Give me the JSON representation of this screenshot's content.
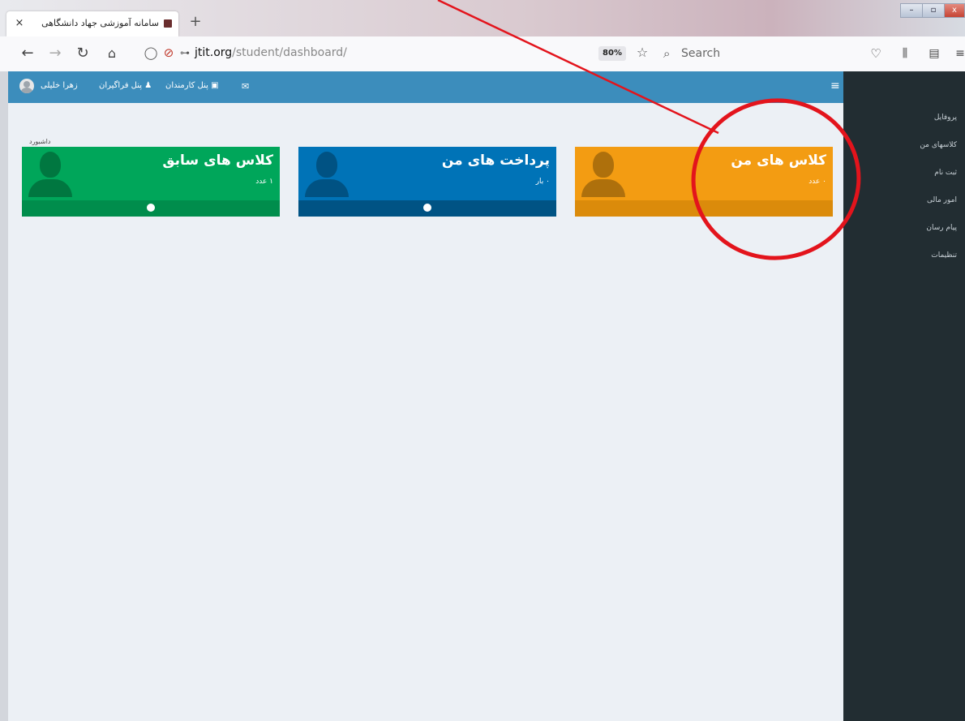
{
  "browser": {
    "tab_title": "سامانه آموزشی جهاد دانشگاهی",
    "tab_close": "×",
    "new_tab": "+",
    "url_domain": "jtit.org",
    "url_path": "/student/dashboard/",
    "zoom": "80%",
    "search_placeholder": "Search"
  },
  "topbar": {
    "user_name": "زهرا خلیلی",
    "trainee_panel": "پنل فراگیران",
    "staff_panel": "پنل کارمندان",
    "menu_icon": "≡"
  },
  "breadcrumb": "داشبورد",
  "cards": [
    {
      "title": "کلاس های سابق",
      "count": "۱ عدد",
      "color": "#00a65a",
      "footer": "#008d4c"
    },
    {
      "title": "پرداخت های من",
      "count": "۰ بار",
      "color": "#0073b7",
      "footer": "#005384"
    },
    {
      "title": "کلاس های من",
      "count": "۰ عدد",
      "color": "#f39c12",
      "footer": "#db8b0b"
    }
  ],
  "sidebar": [
    "پروفایل",
    "کلاسهای من",
    "ثبت نام",
    "امور مالی",
    "پیام رسان",
    "تنظیمات"
  ],
  "annotation": {
    "color": "#e3141c"
  }
}
